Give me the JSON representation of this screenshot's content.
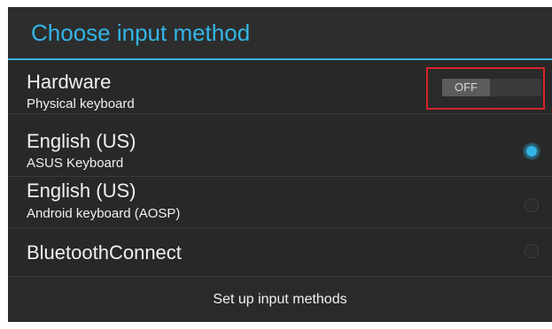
{
  "dialog": {
    "title": "Choose input method",
    "accent_color": "#33b5e5",
    "hardware": {
      "title": "Hardware",
      "subtitle": "Physical keyboard",
      "toggle_state": "OFF",
      "highlight_color": "#d6252b"
    },
    "methods": [
      {
        "title": "English (US)",
        "subtitle": "ASUS Keyboard",
        "selected": true
      },
      {
        "title": "English (US)",
        "subtitle": "Android keyboard (AOSP)",
        "selected": false
      },
      {
        "title": "BluetoothConnect",
        "subtitle": "",
        "selected": false
      }
    ],
    "setup_button": "Set up input methods"
  }
}
